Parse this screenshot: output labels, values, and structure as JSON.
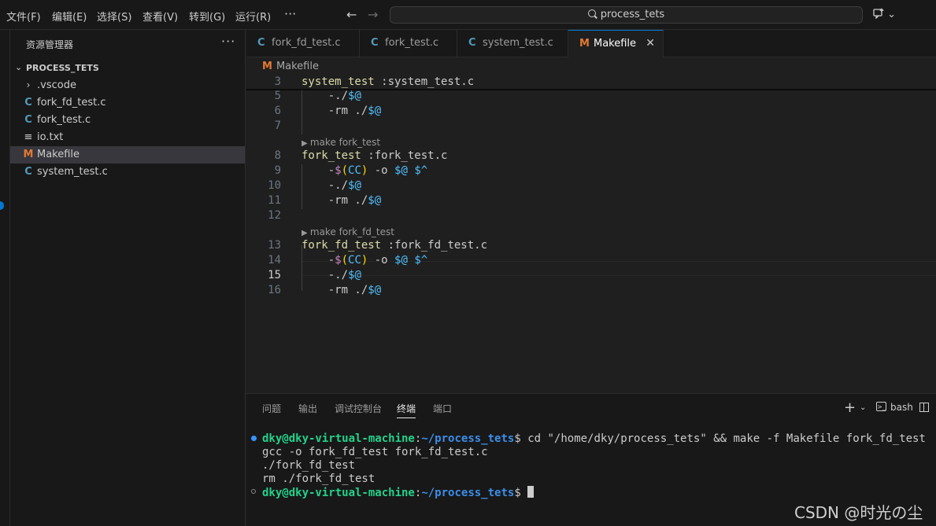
{
  "menu": {
    "items": [
      "文件(F)",
      "编辑(E)",
      "选择(S)",
      "查看(V)",
      "转到(G)",
      "运行(R)"
    ],
    "more": "···"
  },
  "search": {
    "text": "process_tets"
  },
  "copilot": {
    "icon": "copilot-icon",
    "chevron": "⌄"
  },
  "explorer": {
    "title": "资源管理器",
    "more": "···",
    "folder": "PROCESS_TETS",
    "items": [
      {
        "name": ".vscode",
        "icon": "chevron-right-icon",
        "glyph": "›"
      },
      {
        "name": "fork_fd_test.c",
        "icon": "c-file-icon",
        "glyph": "C"
      },
      {
        "name": "fork_test.c",
        "icon": "c-file-icon",
        "glyph": "C"
      },
      {
        "name": "io.txt",
        "icon": "text-file-icon",
        "glyph": "≡"
      },
      {
        "name": "Makefile",
        "icon": "makefile-icon",
        "glyph": "M",
        "selected": true
      },
      {
        "name": "system_test.c",
        "icon": "c-file-icon",
        "glyph": "C"
      }
    ]
  },
  "tabs": [
    {
      "label": "fork_fd_test.c",
      "glyph": "C"
    },
    {
      "label": "fork_test.c",
      "glyph": "C"
    },
    {
      "label": "system_test.c",
      "glyph": "C"
    },
    {
      "label": "Makefile",
      "glyph": "M",
      "active": true,
      "close": "✕"
    }
  ],
  "breadcrumb": {
    "glyph": "M",
    "label": "Makefile"
  },
  "editor": {
    "sticky": {
      "line": "3",
      "target": "system_test",
      "deps": " :system_test.c"
    },
    "lines": [
      {
        "n": "5",
        "prefix": "    -./",
        "var": "$@"
      },
      {
        "n": "6",
        "prefix": "    -rm ./",
        "var": "$@"
      },
      {
        "n": "7"
      },
      {
        "lens": "make fork_test"
      },
      {
        "n": "8",
        "target": "fork_test",
        "deps": " :fork_test.c"
      },
      {
        "n": "9",
        "cmd": true
      },
      {
        "n": "10",
        "prefix": "    -./",
        "var": "$@"
      },
      {
        "n": "11",
        "prefix": "    -rm ./",
        "var": "$@"
      },
      {
        "n": "12"
      },
      {
        "lens": "make fork_fd_test"
      },
      {
        "n": "13",
        "target": "fork_fd_test",
        "deps": " :fork_fd_test.c"
      },
      {
        "n": "14",
        "cmd": true
      },
      {
        "n": "15",
        "prefix": "    -./",
        "var": "$@",
        "active": true
      },
      {
        "n": "16",
        "prefix": "    -rm ./",
        "var": "$@"
      }
    ],
    "cmd_parts": {
      "dash": "    -",
      "dollar": "$",
      "open": "(",
      "cc": "CC",
      "close": ")",
      "mid": " -o ",
      "v1": "$@",
      "sp": " ",
      "v2": "$^"
    }
  },
  "panel": {
    "tabs": [
      "问题",
      "输出",
      "调试控制台",
      "终端",
      "端口"
    ],
    "active_tab": "终端",
    "plus": "+",
    "chevron": "⌄",
    "shell": "bash"
  },
  "terminal": {
    "user": "dky@dky-virtual-machine",
    "sep": ":",
    "path": "~/process_tets",
    "prompt_end": "$",
    "command": " cd \"/home/dky/process_tets\" && make -f Makefile fork_fd_test",
    "output": [
      "gcc -o fork_fd_test fork_fd_test.c",
      "./fork_fd_test",
      "rm ./fork_fd_test"
    ]
  },
  "watermark": "CSDN @时光の尘",
  "colors": {
    "accent": "#0078d4",
    "c_icon": "#519aba",
    "makefile_icon": "#e37933",
    "terminal_user": "#23d18b",
    "terminal_path": "#3b8eea"
  }
}
